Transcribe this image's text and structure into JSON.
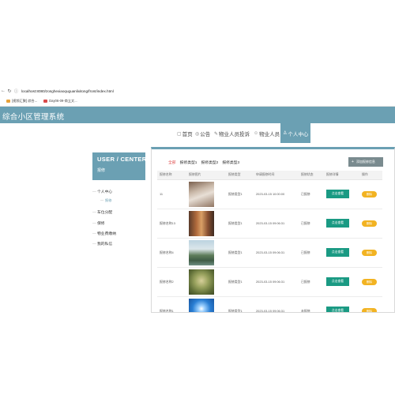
{
  "browser": {
    "url": "localhost:8080/zonghexiaoquguanlixitong/front/index.html",
    "bookmarks": [
      {
        "label": "[视频汇聚] 综合...",
        "color": "#e8a23a"
      },
      {
        "label": "Day06-09-商立文...",
        "color": "#d94a4a"
      }
    ]
  },
  "app": {
    "title": "综合小区管理系统"
  },
  "topnav": [
    {
      "icon": "▢",
      "label": "首页"
    },
    {
      "icon": "◎",
      "label": "公告"
    },
    {
      "icon": "✎",
      "label": "物业人员投诉"
    },
    {
      "icon": "☺",
      "label": "物业人员"
    },
    {
      "icon": "♙",
      "label": "个人中心"
    }
  ],
  "sidebar": {
    "title": "USER / CENTER",
    "subtitle": "报修",
    "items": [
      {
        "label": "个人中心"
      },
      {
        "label": "报修"
      },
      {
        "label": "车位分配"
      },
      {
        "label": "保修"
      },
      {
        "label": "物业费缴纳"
      },
      {
        "label": "我的私信"
      }
    ]
  },
  "panel": {
    "tabs": [
      "全部",
      "报修类型1",
      "报修类型2",
      "报修类型3"
    ],
    "add_label": "添加报修信息",
    "columns": [
      "报修名称",
      "报修图片",
      "报修类型",
      "申请报修时间",
      "报修状态",
      "报修详情",
      "操作"
    ],
    "rows": [
      {
        "name": "11",
        "type": "报修类型1",
        "time": "2023-03-15 10:00:00",
        "status": "已报修",
        "detail": "点击查看",
        "op": "删除"
      },
      {
        "name": "报修名称13",
        "type": "报修类型1",
        "time": "2023-03-15 09:06:31",
        "status": "已报修",
        "detail": "点击查看",
        "op": "删除"
      },
      {
        "name": "报修名称4",
        "type": "报修类型1",
        "time": "2023-03-15 09:06:31",
        "status": "已报修",
        "detail": "点击查看",
        "op": "删除"
      },
      {
        "name": "报修名称2",
        "type": "报修类型1",
        "time": "2023-03-15 09:06:31",
        "status": "已报修",
        "detail": "点击查看",
        "op": "删除"
      },
      {
        "name": "报修名称1",
        "type": "报修类型1",
        "time": "2023-03-15 09:06:31",
        "status": "未报修",
        "detail": "点击查看",
        "op": "删除"
      }
    ]
  },
  "colors": {
    "accent": "#6ba0b3",
    "view_button": "#1a9a83",
    "delete_button": "#f2b322",
    "active_tab": "#e05353"
  }
}
